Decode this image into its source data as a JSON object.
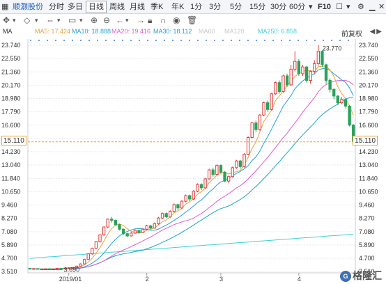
{
  "toolbar": {
    "stock_name": "顺灏股份",
    "periods": [
      "分时",
      "多日",
      "日线",
      "周线",
      "月线",
      "季K",
      "年K",
      "1分",
      "3分",
      "5分",
      "15分",
      "30分",
      "60分"
    ],
    "active_period": "日线",
    "f10": "F10"
  },
  "indicator": {
    "name": "MA",
    "ma5": "MA5: 17.424",
    "ma10": "MA10: 18.888",
    "ma20": "MA20: 19.416",
    "ma30": "MA30: 18.112",
    "ma60": "MA60",
    "ma120": "MA120",
    "ma250": "MA250: 6.858",
    "adjust": "前复权"
  },
  "colors": {
    "up": "#e23b3b",
    "down": "#2aa35a",
    "ma5": "#e8a23c",
    "ma10": "#2a9fd6",
    "ma20": "#e05ad0",
    "ma30": "#1aa3c6",
    "ma250": "#3fd0d6",
    "price_line": "#e8a23c",
    "grid": "#e6e9ee"
  },
  "chart_data": {
    "type": "candlestick",
    "y_ticks": [
      "23.740",
      "22.550",
      "21.360",
      "20.170",
      "18.980",
      "17.790",
      "16.600",
      "15.410",
      "14.230",
      "13.040",
      "11.840",
      "10.650",
      "9.460",
      "8.270",
      "7.080",
      "5.890",
      "4.700",
      "3.510"
    ],
    "y_tick_values": [
      23.74,
      22.55,
      21.36,
      20.17,
      18.98,
      17.79,
      16.6,
      15.41,
      14.23,
      13.04,
      11.84,
      10.65,
      9.46,
      8.27,
      7.08,
      5.89,
      4.7,
      3.51
    ],
    "ylim": [
      3.4,
      24.3
    ],
    "x_labels": [
      "2019/01",
      "2",
      "3",
      "4"
    ],
    "x_label_index": [
      10,
      30,
      49,
      69
    ],
    "high_label": "23.770",
    "low_label": "3.690",
    "current_price": "15.110",
    "candles": [
      [
        3.8,
        3.75,
        3.85,
        3.7
      ],
      [
        3.75,
        3.78,
        3.82,
        3.72
      ],
      [
        3.78,
        3.74,
        3.8,
        3.7
      ],
      [
        3.74,
        3.72,
        3.77,
        3.69
      ],
      [
        3.72,
        3.76,
        3.79,
        3.7
      ],
      [
        3.76,
        3.73,
        3.78,
        3.71
      ],
      [
        3.73,
        3.75,
        3.77,
        3.71
      ],
      [
        3.75,
        3.8,
        3.84,
        3.73
      ],
      [
        3.8,
        3.78,
        3.83,
        3.76
      ],
      [
        3.78,
        3.82,
        3.86,
        3.76
      ],
      [
        3.82,
        3.85,
        3.9,
        3.8
      ],
      [
        3.85,
        3.88,
        3.92,
        3.82
      ],
      [
        3.88,
        4.0,
        4.05,
        3.86
      ],
      [
        4.0,
        4.2,
        4.25,
        3.98
      ],
      [
        4.2,
        4.6,
        4.65,
        4.15
      ],
      [
        4.6,
        5.1,
        5.15,
        4.55
      ],
      [
        5.1,
        5.6,
        5.65,
        5.0
      ],
      [
        5.6,
        6.2,
        6.25,
        5.5
      ],
      [
        6.2,
        6.8,
        6.85,
        6.1
      ],
      [
        6.8,
        7.5,
        7.55,
        6.7
      ],
      [
        7.5,
        8.2,
        8.25,
        7.4
      ],
      [
        8.2,
        8.1,
        8.4,
        7.9
      ],
      [
        8.1,
        7.7,
        8.15,
        7.6
      ],
      [
        7.7,
        7.3,
        7.8,
        7.2
      ],
      [
        7.3,
        6.9,
        7.4,
        6.8
      ],
      [
        6.9,
        6.7,
        7.0,
        6.6
      ],
      [
        6.7,
        6.95,
        7.05,
        6.65
      ],
      [
        6.95,
        7.2,
        7.3,
        6.9
      ],
      [
        7.2,
        7.0,
        7.25,
        6.9
      ],
      [
        7.0,
        7.3,
        7.4,
        6.95
      ],
      [
        7.3,
        7.6,
        7.7,
        7.2
      ],
      [
        7.6,
        7.4,
        7.7,
        7.3
      ],
      [
        7.4,
        7.8,
        7.9,
        7.35
      ],
      [
        7.8,
        8.3,
        8.4,
        7.7
      ],
      [
        8.3,
        8.7,
        8.8,
        8.2
      ],
      [
        8.7,
        8.4,
        8.8,
        8.3
      ],
      [
        8.4,
        8.9,
        9.0,
        8.3
      ],
      [
        8.9,
        9.5,
        9.6,
        8.8
      ],
      [
        9.5,
        9.2,
        9.6,
        9.0
      ],
      [
        9.2,
        9.8,
        9.9,
        9.1
      ],
      [
        9.8,
        10.3,
        10.4,
        9.7
      ],
      [
        10.3,
        10.0,
        10.4,
        9.8
      ],
      [
        10.0,
        10.7,
        10.8,
        9.9
      ],
      [
        10.7,
        11.3,
        11.4,
        10.6
      ],
      [
        11.3,
        11.0,
        11.4,
        10.8
      ],
      [
        11.0,
        11.8,
        11.9,
        10.9
      ],
      [
        11.8,
        12.6,
        12.7,
        11.7
      ],
      [
        12.6,
        12.2,
        12.8,
        12.0
      ],
      [
        12.2,
        13.0,
        13.1,
        12.1
      ],
      [
        13.0,
        12.4,
        13.1,
        12.2
      ],
      [
        12.4,
        11.6,
        12.5,
        11.5
      ],
      [
        11.6,
        12.0,
        12.1,
        11.4
      ],
      [
        12.0,
        12.8,
        12.9,
        11.9
      ],
      [
        12.8,
        13.4,
        13.5,
        12.7
      ],
      [
        13.4,
        12.9,
        13.5,
        12.7
      ],
      [
        12.9,
        14.0,
        14.1,
        12.8
      ],
      [
        14.0,
        15.5,
        15.6,
        13.9
      ],
      [
        15.5,
        16.8,
        16.9,
        15.4
      ],
      [
        16.8,
        16.2,
        17.0,
        16.0
      ],
      [
        16.2,
        17.5,
        17.6,
        16.1
      ],
      [
        17.5,
        18.6,
        18.7,
        17.4
      ],
      [
        18.6,
        18.0,
        18.8,
        17.8
      ],
      [
        18.0,
        19.4,
        19.5,
        17.9
      ],
      [
        19.4,
        20.4,
        20.5,
        19.3
      ],
      [
        20.4,
        19.6,
        20.6,
        19.4
      ],
      [
        19.6,
        21.0,
        21.1,
        19.5
      ],
      [
        21.0,
        20.2,
        21.2,
        20.0
      ],
      [
        20.2,
        21.6,
        22.0,
        20.1
      ],
      [
        21.6,
        22.3,
        23.2,
        21.4
      ],
      [
        22.3,
        21.2,
        22.5,
        21.0
      ],
      [
        21.2,
        21.8,
        22.0,
        21.0
      ],
      [
        21.8,
        20.6,
        21.9,
        20.4
      ],
      [
        20.6,
        21.4,
        21.5,
        20.3
      ],
      [
        21.4,
        22.1,
        22.4,
        21.2
      ],
      [
        22.1,
        23.2,
        23.77,
        21.9
      ],
      [
        23.2,
        22.0,
        23.3,
        21.8
      ],
      [
        22.0,
        20.6,
        22.1,
        20.3
      ],
      [
        20.6,
        19.8,
        20.8,
        19.5
      ],
      [
        19.8,
        19.2,
        19.9,
        18.9
      ],
      [
        19.2,
        18.6,
        19.3,
        18.4
      ],
      [
        18.6,
        18.9,
        19.1,
        18.5
      ],
      [
        18.9,
        18.3,
        19.0,
        18.1
      ],
      [
        18.3,
        16.6,
        18.4,
        16.5
      ],
      [
        16.6,
        15.11,
        16.7,
        15.0
      ]
    ]
  },
  "watermark": "格隆汇"
}
